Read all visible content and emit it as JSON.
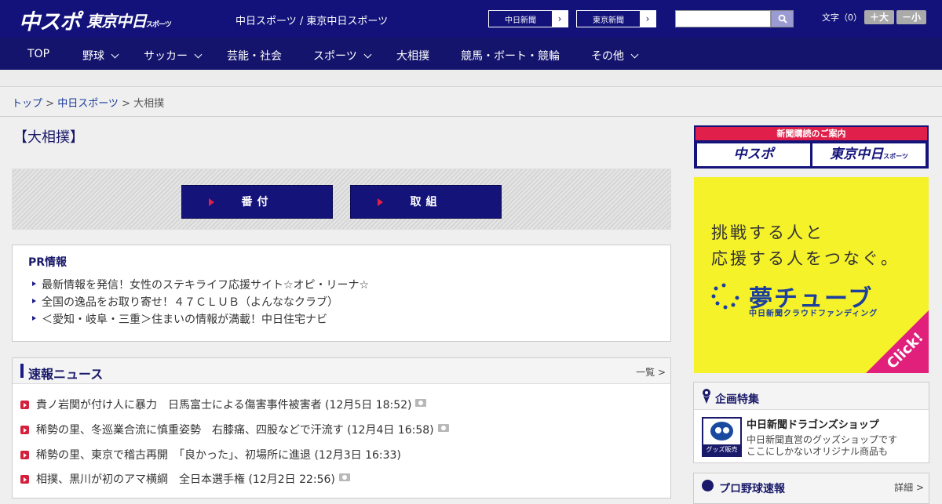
{
  "header": {
    "logo_main": "中スポ",
    "logo_tokyo": "東京中日",
    "logo_tokyo_sub": "スポーツ",
    "site_title": "中日スポーツ / 東京中日スポーツ",
    "paper_links": [
      "中日新聞",
      "東京新聞"
    ],
    "search_placeholder": "",
    "font_size_label": "文字（0）",
    "font_larger": "＋大",
    "font_smaller": "－小"
  },
  "nav": {
    "items": [
      {
        "label": "TOP",
        "has_dropdown": false
      },
      {
        "label": "野球",
        "has_dropdown": true
      },
      {
        "label": "サッカー",
        "has_dropdown": true
      },
      {
        "label": "芸能・社会",
        "has_dropdown": false
      },
      {
        "label": "スポーツ",
        "has_dropdown": true
      },
      {
        "label": "大相撲",
        "has_dropdown": false
      },
      {
        "label": "競馬・ボート・競輪",
        "has_dropdown": false
      },
      {
        "label": "その他",
        "has_dropdown": true
      }
    ]
  },
  "breadcrumb": {
    "home": "トップ",
    "sep": " > ",
    "parent": "中日スポーツ",
    "current": "大相撲"
  },
  "page_title": "【大相撲】",
  "sumo_buttons": [
    "番付",
    "取組"
  ],
  "pr": {
    "heading": "PR情報",
    "items": [
      "最新情報を発信！女性のステキライフ応援サイト☆オピ・リーナ☆",
      "全国の逸品をお取り寄せ！４７ＣＬＵＢ（よんななクラブ）",
      "＜愛知・岐阜・三重＞住まいの情報が満載！中日住宅ナビ"
    ]
  },
  "news": {
    "heading": "速報ニュース",
    "more_label": "一覧 >",
    "items": [
      {
        "text": "貴ノ岩関が付け人に暴力　日馬富士による傷害事件被害者 (12月5日 18:52)",
        "has_photo": true
      },
      {
        "text": "稀勢の里、冬巡業合流に慎重姿勢　右膝痛、四股などで汗流す (12月4日 16:58)",
        "has_photo": true
      },
      {
        "text": "稀勢の里、東京で稽古再開　「良かった」、初場所に進退 (12月3日 16:33)",
        "has_photo": false
      },
      {
        "text": "相撲、黒川が初のアマ横綱　全日本選手権 (12月2日 22:56)",
        "has_photo": true
      }
    ]
  },
  "sidebar": {
    "subscription": {
      "banner_text": "新聞購読のご案内",
      "logo_main": "中スポ",
      "logo_tokyo": "東京中日",
      "logo_tokyo_sub": "スポーツ"
    },
    "yume_ad": {
      "line1": "挑戦する人と",
      "line2": "応援する人をつなぐ。",
      "brand": "夢チューブ",
      "brand_sub": "中日新聞クラウドファンディング",
      "cta": "Click!",
      "bg_color": "#f5f229",
      "accent_color": "#e0207a"
    },
    "feature": {
      "heading": "企画特集",
      "thumb_label": "グッズ販売中",
      "title": "中日新聞ドラゴンズショップ",
      "desc_line1": "中日新聞直営のグッズショップです",
      "desc_line2": "ここにしかないオリジナル商品も"
    },
    "baseball": {
      "heading": "プロ野球速報",
      "more_label": "詳細 >"
    }
  },
  "colors": {
    "navy": "#12127a",
    "red": "#e0204a"
  }
}
